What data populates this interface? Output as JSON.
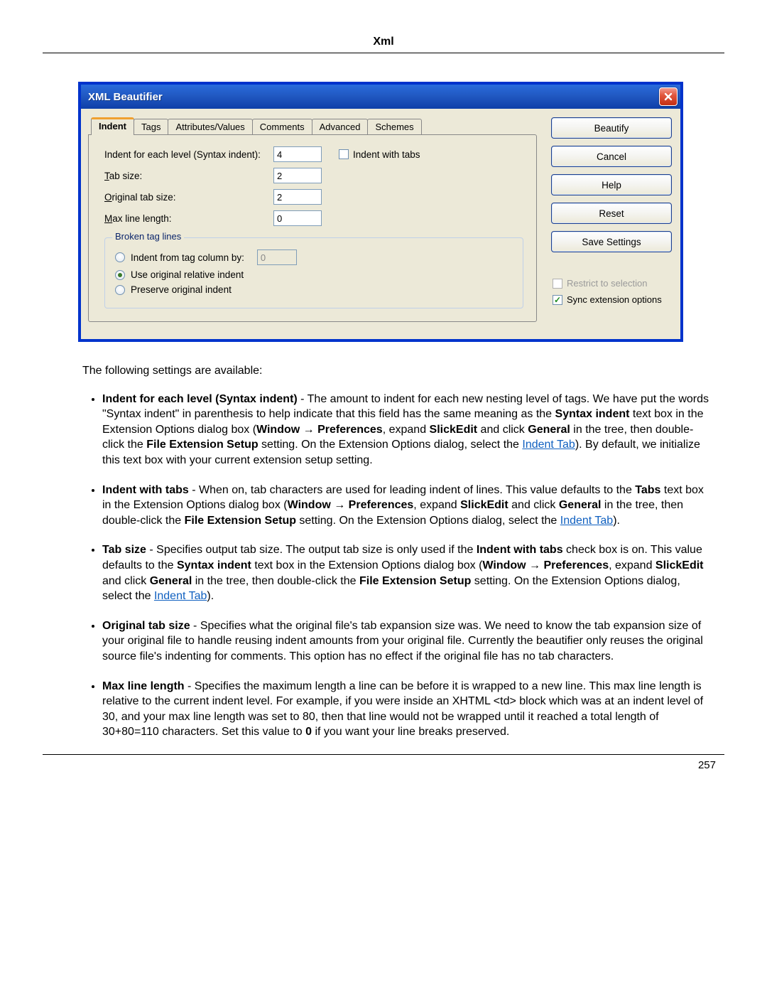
{
  "page": {
    "title": "Xml",
    "number": "257"
  },
  "dialog": {
    "title": "XML Beautifier",
    "tabs": [
      "Indent",
      "Tags",
      "Attributes/Values",
      "Comments",
      "Advanced",
      "Schemes"
    ],
    "selected_tab": 0,
    "labels": {
      "indent_each": "Indent for each level (Syntax indent):",
      "tab_size_pre": "T",
      "tab_size_post": "ab size:",
      "orig_pre": "O",
      "orig_post": "riginal tab size:",
      "max_pre": "M",
      "max_post": "ax line length:",
      "indent_with_tabs": "Indent with tabs"
    },
    "values": {
      "indent_each": "4",
      "tab_size": "2",
      "orig_tab": "2",
      "max_line": "0",
      "indent_from_col": "0"
    },
    "broken": {
      "legend": "Broken tag lines",
      "opt1": "Indent from tag column by:",
      "opt2": "Use original relative indent",
      "opt3": "Preserve original indent"
    },
    "buttons": {
      "beautify": "Beautify",
      "cancel": "Cancel",
      "help": "Help",
      "reset": "Reset",
      "save": "Save Settings"
    },
    "checks": {
      "restrict": "Restrict to selection",
      "sync": "Sync extension options"
    }
  },
  "doc": {
    "intro": "The following settings are available:",
    "link": "Indent Tab",
    "b1": {
      "term": "Indent for each level (Syntax indent)",
      "t1": " - The amount to indent for each new nesting level of tags. We have put the words \"Syntax indent\" in parenthesis to help indicate that this field has the same meaning as the ",
      "b_a": "Syntax indent",
      "t2": " text box in the Extension Options dialog box (",
      "b_b": "Window",
      "arrow": " → ",
      "b_c": "Preferences",
      "t3": ", expand ",
      "b_d": "SlickEdit",
      "t4": " and click ",
      "b_e": "General",
      "t5": " in the tree, then double-click the ",
      "b_f": "File Extension Setup",
      "t6": " setting. On the Extension Options dialog, select the ",
      "t7": "). By default, we initialize this text box with your current extension setup setting."
    },
    "b2": {
      "term": "Indent with tabs",
      "t1": " - When on, tab characters are used for leading indent of lines. This value defaults to the ",
      "b_a": "Tabs",
      "t2": " text box in the Extension Options dialog box (",
      "b_b": "Window",
      "b_c": "Preferences",
      "t3": ", expand ",
      "b_d": "SlickEdit",
      "t4": " and click ",
      "b_e": "General",
      "t5": " in the tree, then double-click the ",
      "b_f": "File Extension Setup",
      "t6": " setting. On the Extension Options dialog, select the ",
      "t7": ")."
    },
    "b3": {
      "term": "Tab size",
      "t1": " - Specifies output tab size. The output tab size is only used if the ",
      "b_a": "Indent with tabs",
      "t2": " check box is on. This value defaults to the ",
      "b_b": "Syntax indent",
      "t3": " text box in the Extension Options dialog box (",
      "b_c": "Window",
      "b_d": "Preferences",
      "t4": ", expand ",
      "b_e": "SlickEdit",
      "t5": " and click ",
      "b_f": "General",
      "t6": " in the tree, then double-click the ",
      "b_g": "File Extension Setup",
      "t7": " setting. On the Extension Options dialog, select the ",
      "t8": ")."
    },
    "b4": {
      "term": "Original tab size",
      "rest": " - Specifies what the original file's tab expansion size was. We need to know the tab expansion size of your original file to handle reusing indent amounts from your original file. Currently the beautifier only reuses the original source file's indenting for comments. This option has no effect if the original file has no tab characters."
    },
    "b5": {
      "term": "Max line length",
      "t1": " - Specifies the maximum length a line can be before it is wrapped to a new line. This max line length is relative to the current indent level. For example, if you were inside an XHTML <td> block which was at an indent level of 30, and your max line length was set to 80, then that line would not be wrapped until it reached a total length of 30+80=110 characters. Set this value to ",
      "b_a": "0",
      "t2": " if you want your line breaks preserved."
    }
  }
}
